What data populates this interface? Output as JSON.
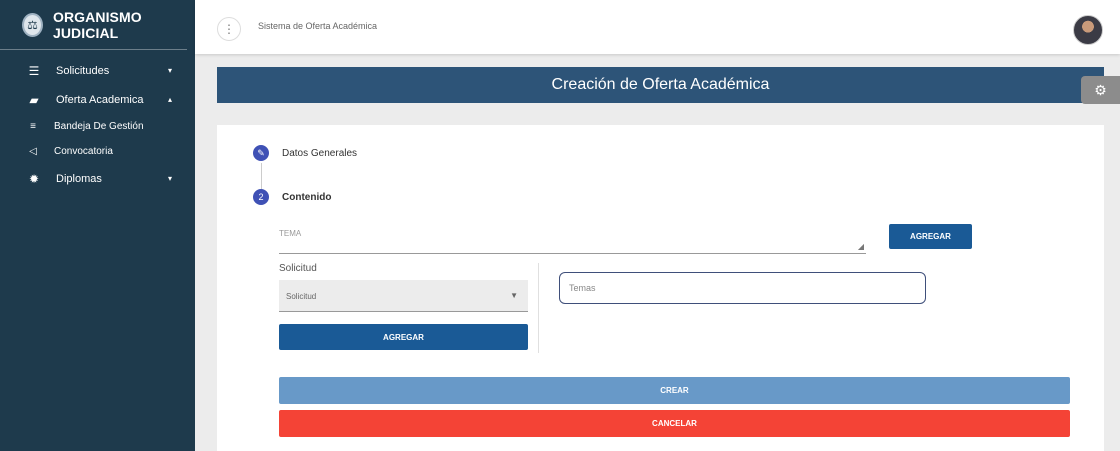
{
  "sidebar": {
    "brand": {
      "title": "ORGANISMO JUDICIAL",
      "logo_icon": "seal-icon"
    },
    "items": [
      {
        "label": "Solicitudes",
        "icon": "server-icon",
        "caret": "▾"
      },
      {
        "label": "Oferta Academica",
        "icon": "book-icon",
        "caret": "▴"
      }
    ],
    "subitems": [
      {
        "label": "Bandeja De Gestión",
        "icon": "list-icon"
      },
      {
        "label": "Convocatoria",
        "icon": "megaphone-icon"
      }
    ],
    "items_after": [
      {
        "label": "Diplomas",
        "icon": "badge-icon",
        "caret": "▾"
      }
    ]
  },
  "header": {
    "system_title": "Sistema de Oferta Académica",
    "menu_icon": "⋮"
  },
  "banner": {
    "title": "Creación de Oferta Académica"
  },
  "stepper": {
    "steps": [
      {
        "icon": "pencil-icon",
        "glyph": "✎",
        "label": "Datos Generales"
      },
      {
        "number": "2",
        "label": "Contenido"
      }
    ]
  },
  "form": {
    "tema_label": "TEMA",
    "agregar_tema_label": "AGREGAR",
    "solicitud_label": "Solicitud",
    "solicitud_selected": "Solicitud",
    "agregar_solicitud_label": "AGREGAR",
    "temas_label": "Temas",
    "crear_label": "CREAR",
    "cancelar_label": "CANCELAR"
  },
  "colors": {
    "sidebar_bg": "#1e3a4c",
    "banner_bg": "#2d5478",
    "primary_button": "#1a5a96",
    "crear_button": "#6899c8",
    "cancelar_button": "#f44336",
    "step_circle": "#3f51b5"
  }
}
